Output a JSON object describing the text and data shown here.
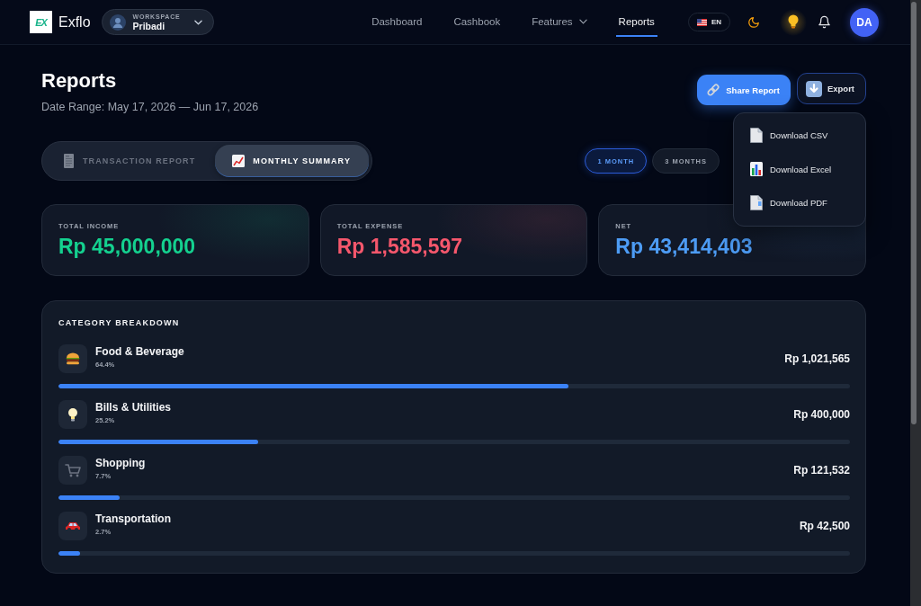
{
  "header": {
    "logo_mark": "EX",
    "brand": "Exflo",
    "workspace": {
      "label": "WORKSPACE",
      "name": "Pribadi"
    },
    "nav": [
      {
        "label": "Dashboard",
        "selected": false,
        "menu": false
      },
      {
        "label": "Cashbook",
        "selected": false,
        "menu": false
      },
      {
        "label": "Features",
        "selected": false,
        "menu": true
      },
      {
        "label": "Reports",
        "selected": true,
        "menu": false
      }
    ],
    "language": "EN",
    "avatar_initials": "DA"
  },
  "page": {
    "title": "Reports",
    "date_range": "Date Range: May 17, 2026 — Jun 17, 2026"
  },
  "actions": [
    {
      "label": "Share Report",
      "kind": "primary"
    },
    {
      "label": "Export",
      "kind": "secondary"
    }
  ],
  "export_menu": {
    "open": true,
    "items": [
      "Download CSV",
      "Download Excel",
      "Download PDF"
    ]
  },
  "report_tabs": [
    {
      "label": "TRANSACTION REPORT",
      "selected": false
    },
    {
      "label": "MONTHLY SUMMARY",
      "selected": true
    }
  ],
  "periods": [
    {
      "label": "1 MONTH",
      "selected": true
    },
    {
      "label": "3 MONTHS",
      "selected": false
    }
  ],
  "summary_cards": [
    {
      "label": "TOTAL INCOME",
      "value": "Rp 45,000,000",
      "color": "#14d18f"
    },
    {
      "label": "TOTAL EXPENSE",
      "value": "Rp 1,585,597",
      "color": "#f5576c"
    },
    {
      "label": "NET",
      "value": "Rp 43,414,403",
      "color": "#4d9cf5"
    }
  ],
  "category_breakdown": {
    "title": "CATEGORY BREAKDOWN",
    "rows": [
      {
        "name": "Food & Beverage",
        "percent": "64.4%",
        "amount": "Rp 1,021,565",
        "level": 0.644
      },
      {
        "name": "Bills & Utilities",
        "percent": "25.2%",
        "amount": "Rp 400,000",
        "level": 0.252
      },
      {
        "name": "Shopping",
        "percent": "7.7%",
        "amount": "Rp 121,532",
        "level": 0.077
      },
      {
        "name": "Transportation",
        "percent": "2.7%",
        "amount": "Rp 42,500",
        "level": 0.027
      }
    ]
  }
}
